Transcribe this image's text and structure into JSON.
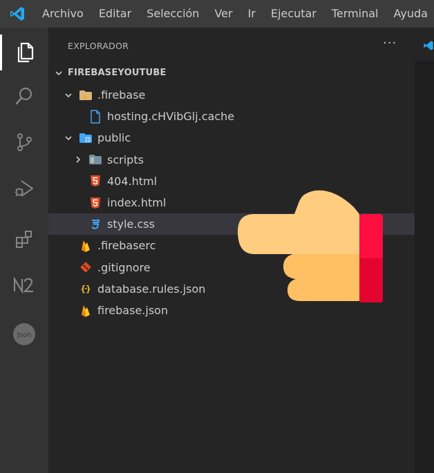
{
  "menu": [
    "Archivo",
    "Editar",
    "Selección",
    "Ver",
    "Ir",
    "Ejecutar",
    "Terminal",
    "Ayuda"
  ],
  "activity_bar": [
    {
      "name": "explorer-icon",
      "active": true
    },
    {
      "name": "search-icon"
    },
    {
      "name": "source-control-icon"
    },
    {
      "name": "run-debug-icon"
    },
    {
      "name": "extensions-icon"
    },
    {
      "name": "n2-extension-icon",
      "label": "N2"
    },
    {
      "name": "json-extension-icon",
      "label": "Json"
    }
  ],
  "explorer": {
    "title": "EXPLORADOR",
    "more": "···",
    "root": "FIREBASEYOUTUBE",
    "items": [
      {
        "label": ".firebase",
        "type": "folder-firebase",
        "expanded": true,
        "depth": 1
      },
      {
        "label": "hosting.cHVibGlj.cache",
        "type": "file-generic",
        "depth": 2
      },
      {
        "label": "public",
        "type": "folder-public",
        "expanded": true,
        "depth": 1
      },
      {
        "label": "scripts",
        "type": "folder-scripts",
        "expanded": false,
        "depth": 2
      },
      {
        "label": "404.html",
        "type": "file-html",
        "depth": 2
      },
      {
        "label": "index.html",
        "type": "file-html",
        "depth": 2
      },
      {
        "label": "style.css",
        "type": "file-css",
        "depth": 2,
        "selected": true
      },
      {
        "label": ".firebaserc",
        "type": "file-firebase",
        "depth": 1
      },
      {
        "label": ".gitignore",
        "type": "file-git",
        "depth": 1
      },
      {
        "label": "database.rules.json",
        "type": "file-json",
        "depth": 1
      },
      {
        "label": "firebase.json",
        "type": "file-firebase",
        "depth": 1
      }
    ]
  },
  "colors": {
    "titlebar": "#3c3c3c",
    "activity_bar": "#333333",
    "sidebar": "#252526",
    "selected_row": "#37373d",
    "html_icon": "#e44d26",
    "css_icon": "#42a5f5",
    "firebase_icon": "#ffca28",
    "folder": "#dcb67a",
    "hand_skin": "#ffcc80",
    "hand_cuff": "#e8002f"
  },
  "overlay": {
    "name": "pointing-hand-icon"
  }
}
